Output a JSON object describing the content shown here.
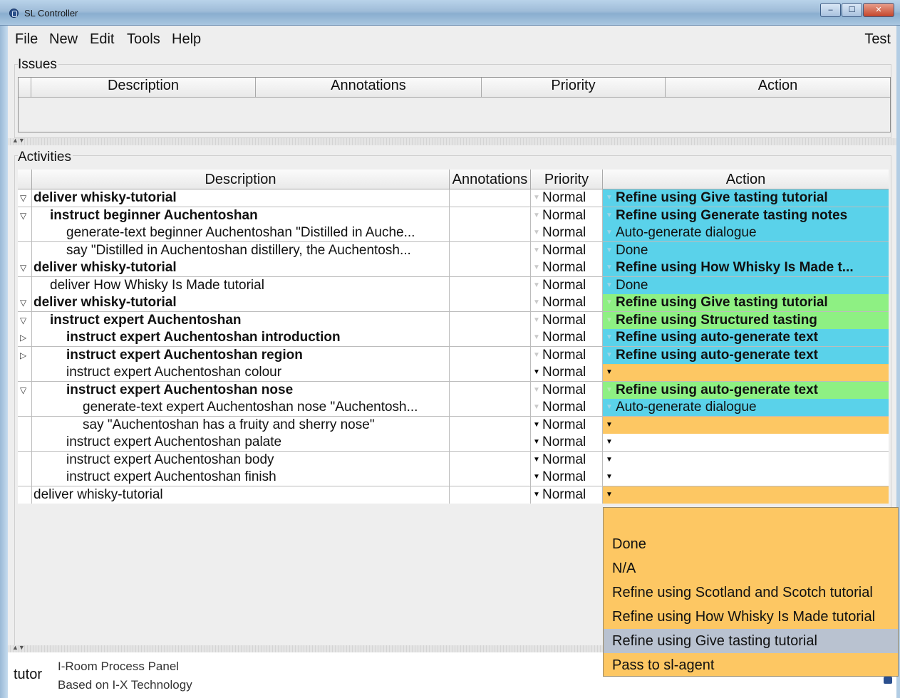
{
  "window": {
    "title": "SL Controller",
    "controls": [
      "–",
      "☐",
      "✕"
    ]
  },
  "menu": {
    "items": [
      "File",
      "New",
      "Edit",
      "Tools",
      "Help"
    ],
    "right_label": "Test"
  },
  "issues": {
    "label": "Issues",
    "columns": [
      "Description",
      "Annotations",
      "Priority",
      "Action"
    ]
  },
  "activities": {
    "label": "Activities",
    "columns": [
      "Description",
      "Annotations",
      "Priority",
      "Action"
    ],
    "rows": [
      {
        "tri": "down",
        "indent": 0,
        "bold": true,
        "desc": "deliver whisky-tutorial",
        "priority": "Normal",
        "pri_arrow": "faint",
        "action": "Refine using Give tasting tutorial",
        "act_bg": "cyan",
        "act_bold": true
      },
      {
        "tri": "down",
        "indent": 1,
        "bold": true,
        "desc": "instruct beginner Auchentoshan",
        "priority": "Normal",
        "pri_arrow": "faint",
        "action": "Refine using Generate tasting notes",
        "act_bg": "cyan",
        "act_bold": true
      },
      {
        "tri": "",
        "indent": 2,
        "bold": false,
        "desc": "generate-text beginner Auchentoshan \"Distilled in Auche...",
        "priority": "Normal",
        "pri_arrow": "faint",
        "action": "Auto-generate dialogue",
        "act_bg": "cyan",
        "act_bold": false
      },
      {
        "tri": "",
        "indent": 2,
        "bold": false,
        "desc": "say \"Distilled in Auchentoshan distillery, the Auchentosh...",
        "priority": "Normal",
        "pri_arrow": "faint",
        "action": "Done",
        "act_bg": "cyan",
        "act_bold": false
      },
      {
        "tri": "down",
        "indent": 0,
        "bold": true,
        "desc": "deliver whisky-tutorial",
        "priority": "Normal",
        "pri_arrow": "faint",
        "action": "Refine using How Whisky Is Made t...",
        "act_bg": "cyan",
        "act_bold": true
      },
      {
        "tri": "",
        "indent": 1,
        "bold": false,
        "desc": "deliver How Whisky Is Made tutorial",
        "priority": "Normal",
        "pri_arrow": "faint",
        "action": "Done",
        "act_bg": "cyan",
        "act_bold": false
      },
      {
        "tri": "down",
        "indent": 0,
        "bold": true,
        "desc": "deliver whisky-tutorial",
        "priority": "Normal",
        "pri_arrow": "faint",
        "action": "Refine using Give tasting tutorial",
        "act_bg": "green",
        "act_bold": true
      },
      {
        "tri": "down",
        "indent": 1,
        "bold": true,
        "desc": "instruct expert Auchentoshan",
        "priority": "Normal",
        "pri_arrow": "faint",
        "action": "Refine using Structured tasting",
        "act_bg": "green",
        "act_bold": true
      },
      {
        "tri": "right",
        "indent": 2,
        "bold": true,
        "desc": "instruct expert Auchentoshan introduction",
        "priority": "Normal",
        "pri_arrow": "faint",
        "action": "Refine using auto-generate text",
        "act_bg": "cyan",
        "act_bold": true
      },
      {
        "tri": "right",
        "indent": 2,
        "bold": true,
        "desc": "instruct expert Auchentoshan region",
        "priority": "Normal",
        "pri_arrow": "faint",
        "action": "Refine using auto-generate text",
        "act_bg": "cyan",
        "act_bold": true
      },
      {
        "tri": "",
        "indent": 2,
        "bold": false,
        "desc": "instruct expert Auchentoshan colour",
        "priority": "Normal",
        "pri_arrow": "dark",
        "action": "",
        "act_bg": "orange",
        "act_bold": false
      },
      {
        "tri": "down",
        "indent": 2,
        "bold": true,
        "desc": "instruct expert Auchentoshan nose",
        "priority": "Normal",
        "pri_arrow": "faint",
        "action": "Refine using auto-generate text",
        "act_bg": "green",
        "act_bold": true
      },
      {
        "tri": "",
        "indent": 3,
        "bold": false,
        "desc": "generate-text expert Auchentoshan nose \"Auchentosh...",
        "priority": "Normal",
        "pri_arrow": "faint",
        "action": "Auto-generate dialogue",
        "act_bg": "cyan",
        "act_bold": false
      },
      {
        "tri": "",
        "indent": 3,
        "bold": false,
        "desc": "say \"Auchentoshan has a fruity and sherry nose\"",
        "priority": "Normal",
        "pri_arrow": "dark",
        "action": "",
        "act_bg": "orange",
        "act_bold": false
      },
      {
        "tri": "",
        "indent": 2,
        "bold": false,
        "desc": "instruct expert Auchentoshan palate",
        "priority": "Normal",
        "pri_arrow": "dark",
        "action": "",
        "act_bg": "white",
        "act_bold": false
      },
      {
        "tri": "",
        "indent": 2,
        "bold": false,
        "desc": "instruct expert Auchentoshan body",
        "priority": "Normal",
        "pri_arrow": "dark",
        "action": "",
        "act_bg": "white",
        "act_bold": false
      },
      {
        "tri": "",
        "indent": 2,
        "bold": false,
        "desc": "instruct expert Auchentoshan finish",
        "priority": "Normal",
        "pri_arrow": "dark",
        "action": "",
        "act_bg": "white",
        "act_bold": false
      },
      {
        "tri": "",
        "indent": 0,
        "bold": false,
        "desc": "deliver whisky-tutorial",
        "priority": "Normal",
        "pri_arrow": "dark",
        "action": "",
        "act_bg": "orange",
        "act_bold": false
      }
    ]
  },
  "popup": {
    "items": [
      "Done",
      "N/A",
      "Refine using Scotland and Scotch tutorial",
      "Refine using How Whisky Is Made tutorial",
      "Refine using Give tasting tutorial",
      "Pass to sl-agent"
    ],
    "highlighted": "Refine using Give tasting tutorial"
  },
  "footer": {
    "logo": "tutor",
    "line1": "I-Room Process Panel",
    "line2": "Based on I-X Technology"
  },
  "colors": {
    "cyan": "#5ad2ea",
    "green": "#8ef083",
    "orange": "#fdc763",
    "highlight": "#b9c2d0"
  }
}
